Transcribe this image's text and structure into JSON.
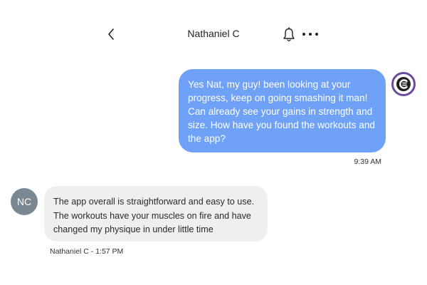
{
  "header": {
    "title": "Nathaniel C",
    "back_icon": "chevron-left-icon",
    "bell_icon": "bell-icon",
    "more_icon": "more-horizontal-icon"
  },
  "messages": [
    {
      "direction": "outgoing",
      "text": "Yes Nat, my  guy! been looking at your progress, keep on going smashing it man! Can already see your gains in strength and size. How have you found the workouts and the app?",
      "time": "9:39 AM",
      "avatar_icon": "brand-logo-icon",
      "bubble_color": "#6fa2f7"
    },
    {
      "direction": "incoming",
      "avatar_initials": "NC",
      "text": "The app overall is straightforward and easy to use. The workouts have your muscles on fire and have changed my physique in under little time",
      "meta": "Nathaniel C - 1:57 PM",
      "bubble_color": "#efefef"
    }
  ],
  "colors": {
    "brand_ring": "#6a4b9c",
    "avatar_bg": "#7b8791"
  }
}
